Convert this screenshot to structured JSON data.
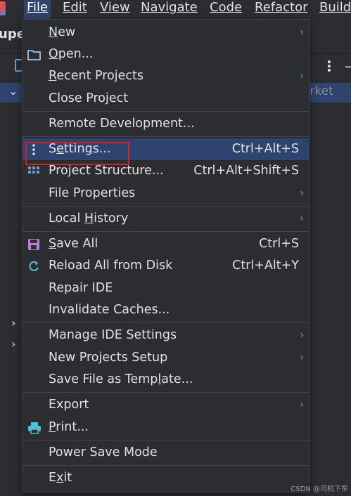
{
  "menubar": {
    "items": [
      {
        "label": "File",
        "mnemonic_index": 0
      },
      {
        "label": "Edit",
        "mnemonic_index": 0
      },
      {
        "label": "View",
        "mnemonic_index": 0
      },
      {
        "label": "Navigate",
        "mnemonic_index": 0
      },
      {
        "label": "Code",
        "mnemonic_index": 0
      },
      {
        "label": "Refactor",
        "mnemonic_index": 0
      },
      {
        "label": "Build",
        "mnemonic_index": 0
      }
    ]
  },
  "background": {
    "project_title": "upe",
    "tree_row_text": "arket"
  },
  "file_menu": {
    "items": [
      {
        "label": "New",
        "mnemonic": "N",
        "shortcut": "",
        "submenu": true,
        "icon": ""
      },
      {
        "label": "Open...",
        "mnemonic": "O",
        "shortcut": "",
        "submenu": false,
        "icon": "folder-icon"
      },
      {
        "label": "Recent Projects",
        "mnemonic": "R",
        "shortcut": "",
        "submenu": true,
        "icon": ""
      },
      {
        "label": "Close Project",
        "mnemonic": "",
        "shortcut": "",
        "submenu": false,
        "icon": ""
      },
      {
        "label": "Remote Development...",
        "mnemonic": "",
        "shortcut": "",
        "submenu": false,
        "icon": ""
      },
      {
        "label": "Settings...",
        "mnemonic": "t",
        "shortcut": "Ctrl+Alt+S",
        "submenu": false,
        "icon": "settings-dots-icon",
        "highlighted": true
      },
      {
        "label": "Project Structure...",
        "mnemonic": "",
        "shortcut": "Ctrl+Alt+Shift+S",
        "submenu": false,
        "icon": "project-structure-icon"
      },
      {
        "label": "File Properties",
        "mnemonic": "",
        "shortcut": "",
        "submenu": true,
        "icon": ""
      },
      {
        "label": "Local History",
        "mnemonic": "H",
        "shortcut": "",
        "submenu": true,
        "icon": ""
      },
      {
        "label": "Save All",
        "mnemonic": "S",
        "shortcut": "Ctrl+S",
        "submenu": false,
        "icon": "save-icon"
      },
      {
        "label": "Reload All from Disk",
        "mnemonic": "",
        "shortcut": "Ctrl+Alt+Y",
        "submenu": false,
        "icon": "reload-icon"
      },
      {
        "label": "Repair IDE",
        "mnemonic": "",
        "shortcut": "",
        "submenu": false,
        "icon": ""
      },
      {
        "label": "Invalidate Caches...",
        "mnemonic": "",
        "shortcut": "",
        "submenu": false,
        "icon": ""
      },
      {
        "label": "Manage IDE Settings",
        "mnemonic": "",
        "shortcut": "",
        "submenu": true,
        "icon": ""
      },
      {
        "label": "New Projects Setup",
        "mnemonic": "",
        "shortcut": "",
        "submenu": true,
        "icon": ""
      },
      {
        "label": "Save File as Template...",
        "mnemonic": "l",
        "shortcut": "",
        "submenu": false,
        "icon": ""
      },
      {
        "label": "Export",
        "mnemonic": "",
        "shortcut": "",
        "submenu": true,
        "icon": ""
      },
      {
        "label": "Print...",
        "mnemonic": "P",
        "shortcut": "",
        "submenu": false,
        "icon": "print-icon"
      },
      {
        "label": "Power Save Mode",
        "mnemonic": "",
        "shortcut": "",
        "submenu": false,
        "icon": ""
      },
      {
        "label": "Exit",
        "mnemonic": "x",
        "shortcut": "",
        "submenu": false,
        "icon": ""
      }
    ]
  },
  "watermark": "CSDN @司机下车",
  "colors": {
    "menu_bg": "#2b2d30",
    "highlight_bg": "#2e436e",
    "text": "#dfe1e5",
    "arrow": "#6f9bd8",
    "annotation_red": "#e21b1b"
  }
}
